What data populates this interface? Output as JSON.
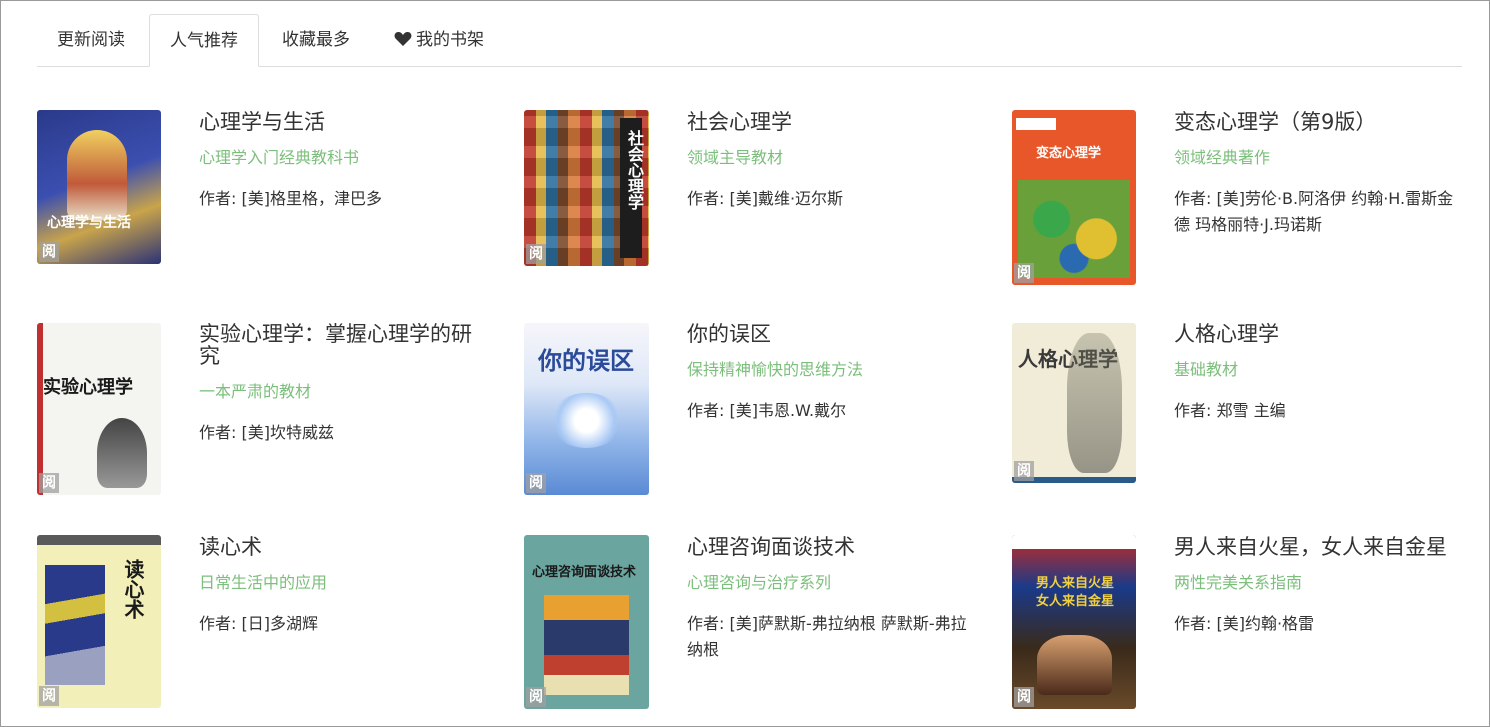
{
  "tabs": [
    {
      "label": "更新阅读"
    },
    {
      "label": "人气推荐"
    },
    {
      "label": "收藏最多"
    },
    {
      "label": "我的书架"
    }
  ],
  "read_badge": "阅",
  "author_prefix": "作者: ",
  "colors": {
    "accent_green": "#7cbf7c",
    "border": "#dddddd",
    "heart": "#333333"
  },
  "books": [
    {
      "title": "心理学与生活",
      "subtitle": "心理学入门经典教科书",
      "author": "[美]格里格，津巴多",
      "cover_text": "心理学与生活"
    },
    {
      "title": "社会心理学",
      "subtitle": "领域主导教材",
      "author": "[美]戴维·迈尔斯",
      "cover_text": "社会心理学"
    },
    {
      "title": "变态心理学（第9版）",
      "subtitle": "领域经典著作",
      "author": "[美]劳伦·B.阿洛伊 约翰·H.雷斯金德 玛格丽特·J.玛诺斯",
      "cover_text": "变态心理学"
    },
    {
      "title": "实验心理学：掌握心理学的研究",
      "subtitle": "一本严肃的教材",
      "author": "[美]坎特威兹",
      "cover_text": "实验心理学"
    },
    {
      "title": "你的误区",
      "subtitle": "保持精神愉快的思维方法",
      "author": "[美]韦恩.W.戴尔",
      "cover_text": "你的误区"
    },
    {
      "title": "人格心理学",
      "subtitle": "基础教材",
      "author": "郑雪 主编",
      "cover_text": "人格心理学"
    },
    {
      "title": "读心术",
      "subtitle": "日常生活中的应用",
      "author": "[日]多湖辉",
      "cover_text": "读心术"
    },
    {
      "title": "心理咨询面谈技术",
      "subtitle": "心理咨询与治疗系列",
      "author": "[美]萨默斯-弗拉纳根 萨默斯-弗拉纳根",
      "cover_text": "心理咨询面谈技术"
    },
    {
      "title": "男人来自火星，女人来自金星",
      "subtitle": "两性完美关系指南",
      "author": "[美]约翰·格雷",
      "cover_text": "男人来自火星 女人来自金星"
    }
  ]
}
